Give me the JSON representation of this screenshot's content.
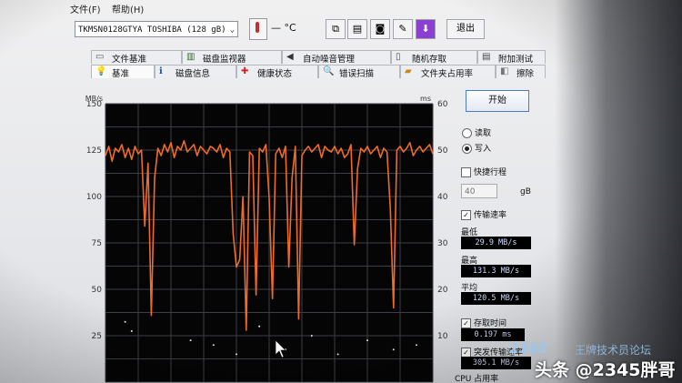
{
  "menu": {
    "file": "文件(F)",
    "help": "帮助(H)"
  },
  "toolbar": {
    "device": "TKMSN0128GTYA TOSHIBA (128 gB)",
    "temperature": "— °C",
    "exit_label": "退出"
  },
  "tabs_row1": [
    {
      "icon": "file-benchmark-icon",
      "label": "文件基准"
    },
    {
      "icon": "disk-monitor-icon",
      "label": "磁盘监视器"
    },
    {
      "icon": "speaker-icon",
      "label": "自动噪音管理"
    },
    {
      "icon": "random-access-icon",
      "label": "随机存取"
    },
    {
      "icon": "extra-tests-icon",
      "label": "附加测试"
    }
  ],
  "tabs_row2": [
    {
      "icon": "benchmark-icon",
      "label": "基准"
    },
    {
      "icon": "disk-info-icon",
      "label": "磁盘信息"
    },
    {
      "icon": "health-cross-icon",
      "label": "健康状态"
    },
    {
      "icon": "magnifier-icon",
      "label": "错误扫描"
    },
    {
      "icon": "folder-icon",
      "label": "文件夹占用率"
    },
    {
      "icon": "eraser-icon",
      "label": "擦除"
    }
  ],
  "panel": {
    "start_label": "开始",
    "read_label": "读取",
    "write_label": "写入",
    "selected_mode": "write",
    "short_stroke_label": "快捷行程",
    "short_stroke_value": "40",
    "short_stroke_unit": "gB",
    "transfer_rate_label": "传输速率",
    "min_label": "最低",
    "min_value": "29.9 MB/s",
    "max_label": "最高",
    "max_value": "131.3 MB/s",
    "avg_label": "平均",
    "avg_value": "120.5 MB/s",
    "access_time_label": "存取时间",
    "access_time_value": "0.197 ms",
    "burst_rate_label": "突发传输速率",
    "burst_rate_value": "305.1 MB/s",
    "cpu_label": "CPU 占用率"
  },
  "chart_data": {
    "type": "line",
    "y_left_unit": "MB/s",
    "y_right_unit": "ms",
    "y_left_ticks": [
      150,
      125,
      100,
      75,
      50,
      25
    ],
    "y_right_ticks": [
      60,
      50,
      40,
      30,
      20,
      10
    ],
    "ylim": [
      0,
      150
    ],
    "grid": true,
    "series": [
      {
        "color": "#f06a2a",
        "x": [
          0,
          1,
          2,
          3,
          4,
          5,
          6,
          7,
          8,
          9,
          10,
          11,
          12,
          13,
          14,
          15,
          16,
          17,
          18,
          19,
          20,
          21,
          22,
          23,
          24,
          25,
          26,
          27,
          28,
          29,
          30,
          31,
          32,
          33,
          34,
          35,
          36,
          37,
          38,
          39,
          40,
          41,
          42,
          43,
          44,
          45,
          46,
          47,
          48,
          49,
          50,
          51,
          52,
          53,
          54,
          55,
          56,
          57,
          58,
          59,
          60,
          61,
          62,
          63,
          64,
          65,
          66,
          67,
          68,
          69,
          70,
          71,
          72,
          73,
          74,
          75,
          76,
          77,
          78,
          79,
          80,
          81,
          82,
          83,
          84,
          85,
          86,
          87,
          88,
          89,
          90,
          91,
          92,
          93,
          94,
          95,
          96,
          97,
          98,
          99,
          100
        ],
        "values": [
          122,
          127,
          119,
          126,
          124,
          128,
          121,
          126,
          120,
          127,
          123,
          125,
          84,
          118,
          36,
          110,
          126,
          122,
          128,
          124,
          129,
          121,
          127,
          125,
          130,
          124,
          126,
          128,
          122,
          127,
          125,
          123,
          127,
          126,
          124,
          128,
          121,
          126,
          124,
          80,
          62,
          66,
          100,
          28,
          124,
          122,
          47,
          126,
          124,
          128,
          99,
          45,
          123,
          126,
          121,
          127,
          62,
          110,
          127,
          34,
          122,
          125,
          127,
          124,
          126,
          128,
          121,
          127,
          125,
          124,
          127,
          123,
          126,
          121,
          123,
          128,
          74,
          115,
          126,
          124,
          127,
          123,
          125,
          127,
          121,
          126,
          124,
          94,
          40,
          125,
          127,
          124,
          126,
          129,
          122,
          125,
          127,
          124,
          126,
          128,
          123
        ]
      }
    ],
    "access_points_ms": [
      [
        6,
        13
      ],
      [
        8,
        11
      ],
      [
        26,
        9
      ],
      [
        33,
        8
      ],
      [
        40,
        6
      ],
      [
        47,
        12
      ],
      [
        55,
        7
      ],
      [
        63,
        10
      ],
      [
        71,
        6
      ],
      [
        80,
        9
      ],
      [
        88,
        7
      ],
      [
        95,
        8
      ]
    ]
  },
  "watermark": {
    "logo": "2345",
    "subtitle": "王牌技术员论坛",
    "handle": "头条 @2345胖哥"
  }
}
